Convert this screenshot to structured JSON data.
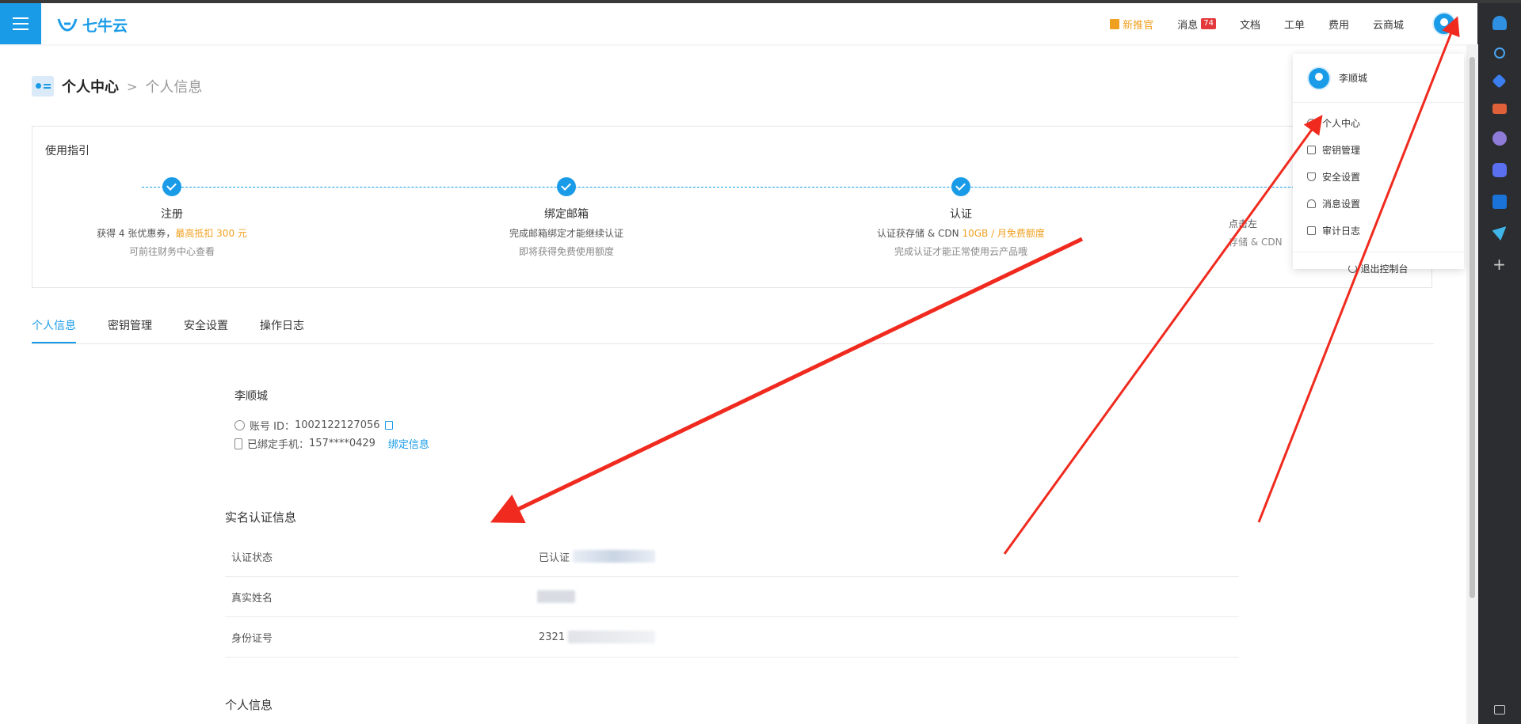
{
  "header": {
    "logo_text": "七牛云",
    "nav": [
      {
        "label": "新推官",
        "icon": "gift-icon"
      },
      {
        "label": "消息",
        "badge": "74"
      },
      {
        "label": "文档"
      },
      {
        "label": "工单"
      },
      {
        "label": "费用"
      },
      {
        "label": "云商城"
      }
    ]
  },
  "breadcrumb": {
    "main": "个人中心",
    "sep": ">",
    "sub": "个人信息"
  },
  "guide": {
    "title": "使用指引",
    "steps": [
      {
        "name": "注册",
        "line1_a": "获得 4 张优惠券，",
        "line1_b": "最高抵扣 300 元",
        "line2": "可前往财务中心查看"
      },
      {
        "name": "绑定邮箱",
        "line1_a": "完成邮箱绑定才能继续认证",
        "line1_b": "",
        "line2": "即将获得免费使用额度"
      },
      {
        "name": "认证",
        "line1_a": "认证获存储 & CDN ",
        "line1_b": "10GB / 月免费额度",
        "line2": "完成认证才能正常使用云产品哦"
      },
      {
        "name": "",
        "line1_a": "点击左",
        "line1_b": "",
        "line2": "存储 & CDN"
      }
    ]
  },
  "tabs": [
    "个人信息",
    "密钥管理",
    "安全设置",
    "操作日志"
  ],
  "profile": {
    "name": "李顺城",
    "account_label": "账号 ID：",
    "account_id": "1002122127056",
    "phone_label": "已绑定手机：",
    "phone": "157****0429",
    "phone_link": "绑定信息"
  },
  "realname": {
    "title": "实名认证信息",
    "rows": [
      {
        "label": "认证状态",
        "value": "已认证"
      },
      {
        "label": "真实姓名",
        "value": ""
      },
      {
        "label": "身份证号",
        "value": "2321"
      }
    ]
  },
  "personal_title": "个人信息",
  "dropdown": {
    "user": "李顺城",
    "items": [
      "个人中心",
      "密钥管理",
      "安全设置",
      "消息设置",
      "审计日志"
    ],
    "logout": "退出控制台"
  },
  "colors": {
    "accent": "#1a9be8",
    "orange": "#f0a020",
    "annotation": "#f02a1e"
  }
}
